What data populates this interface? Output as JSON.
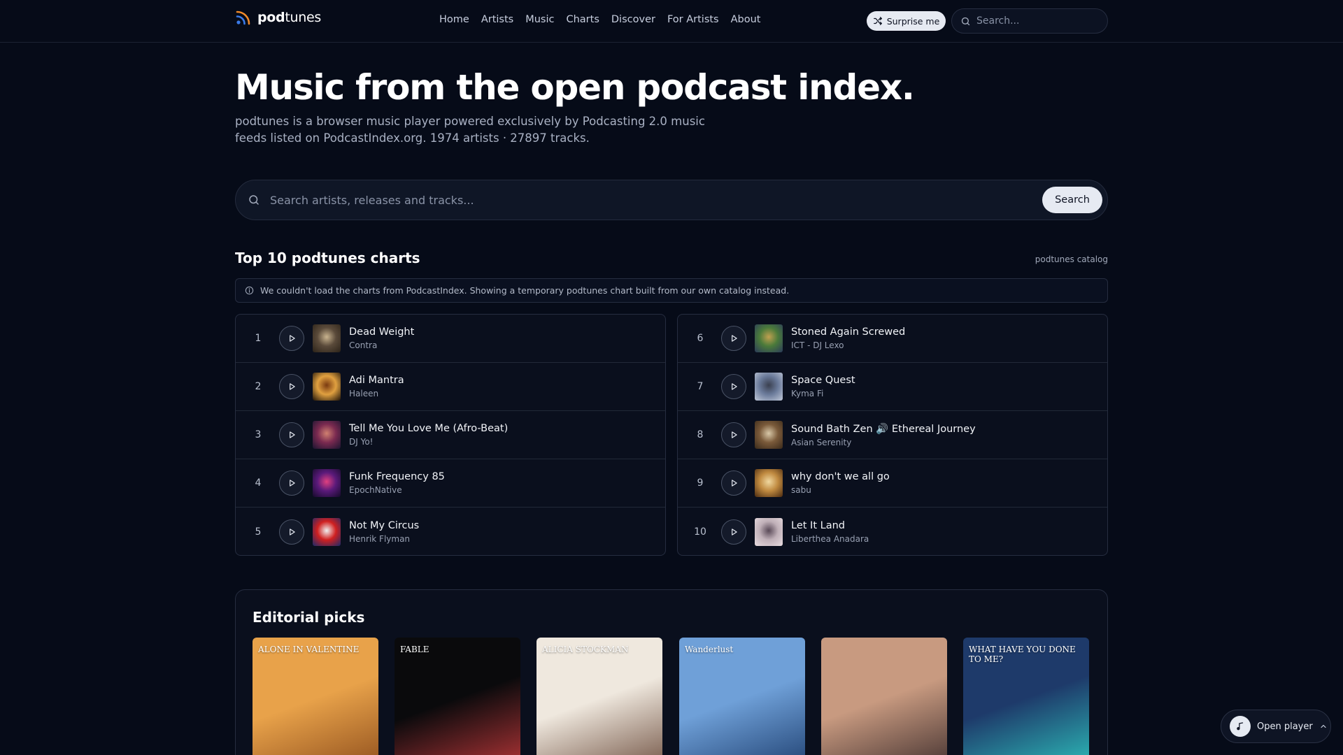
{
  "header": {
    "logo_text_bold": "pod",
    "logo_text_rest": "tunes",
    "nav": [
      "Home",
      "Artists",
      "Music",
      "Charts",
      "Discover",
      "For Artists",
      "About"
    ],
    "surprise_label": "Surprise me",
    "search_placeholder": "Search..."
  },
  "hero": {
    "title": "Music from the open podcast index.",
    "subtitle": "podtunes is a browser music player powered exclusively by Podcasting 2.0 music feeds listed on PodcastIndex.org. 1974 artists · 27897 tracks."
  },
  "main_search": {
    "placeholder": "Search artists, releases and tracks...",
    "button_label": "Search"
  },
  "charts": {
    "title": "Top 10 podtunes charts",
    "source_label": "podtunes catalog",
    "notice": "We couldn't load the charts from PodcastIndex. Showing a temporary podtunes chart built from our own catalog instead.",
    "left": [
      {
        "rank": "1",
        "title": "Dead Weight",
        "artist": "Contra",
        "art": [
          "#5a4a3a",
          "#c9b48f",
          "#2b2218"
        ]
      },
      {
        "rank": "2",
        "title": "Adi Mantra",
        "artist": "Haleen",
        "art": [
          "#e0a040",
          "#7a3a10",
          "#1d1208"
        ]
      },
      {
        "rank": "3",
        "title": "Tell Me You Love Me (Afro-Beat)",
        "artist": "DJ Yo!",
        "art": [
          "#7a2a50",
          "#d08070",
          "#1a1430"
        ]
      },
      {
        "rank": "4",
        "title": "Funk Frequency 85",
        "artist": "EpochNative",
        "art": [
          "#5a1a7a",
          "#e04080",
          "#150a2a"
        ]
      },
      {
        "rank": "5",
        "title": "Not My Circus",
        "artist": "Henrik Flyman",
        "art": [
          "#d02020",
          "#f0f0f0",
          "#1a2a6a"
        ]
      }
    ],
    "right": [
      {
        "rank": "6",
        "title": "Stoned Again Screwed",
        "artist": "ICT - DJ Lexo",
        "art": [
          "#4a7a3a",
          "#c0a050",
          "#2a3a5a"
        ]
      },
      {
        "rank": "7",
        "title": "Space Quest",
        "artist": "Kyma Fi",
        "art": [
          "#6a7a9a",
          "#3a4050",
          "#c0c8d8"
        ]
      },
      {
        "rank": "8",
        "title": "Sound Bath Zen 🔊 Ethereal Journey",
        "artist": "Asian Serenity",
        "art": [
          "#7a5a3a",
          "#d8c8a8",
          "#3a2a1a"
        ]
      },
      {
        "rank": "9",
        "title": "why don't we all go",
        "artist": "sabu",
        "art": [
          "#c08a40",
          "#f0d8a0",
          "#4a2a10"
        ]
      },
      {
        "rank": "10",
        "title": "Let It Land",
        "artist": "Liberthea Anadara",
        "art": [
          "#c0b0b8",
          "#5a4a58",
          "#e8dce0"
        ]
      }
    ]
  },
  "editorial": {
    "title": "Editorial picks",
    "picks": [
      {
        "name": "pick-alone-in-valentine",
        "label": "ALONE IN VALENTINE",
        "bg": "#e8a24a",
        "accent": "#8a4a1a"
      },
      {
        "name": "pick-fable-trickster",
        "label": "FABLE",
        "bg": "#0a0a0c",
        "accent": "#c0383a"
      },
      {
        "name": "pick-alicia-stockman",
        "label": "ALICIA STOCKMAN",
        "bg": "#efe8de",
        "accent": "#6a4a3a"
      },
      {
        "name": "pick-wanderlust-kosmos",
        "label": "Wanderlust",
        "bg": "#6fa0d8",
        "accent": "#1a3a6a"
      },
      {
        "name": "pick-child-photo",
        "label": "",
        "bg": "#c89a80",
        "accent": "#3a2a2a"
      },
      {
        "name": "pick-what-have-you-done",
        "label": "WHAT HAVE YOU DONE TO ME?",
        "bg": "#1e3a6a",
        "accent": "#2ec8c0"
      }
    ]
  },
  "player": {
    "label": "Open player"
  },
  "colors": {
    "background": "#060b18",
    "accent_light": "#e6eaf2",
    "logo_orange": "#f08a2a",
    "logo_blue": "#3a7ae8"
  }
}
